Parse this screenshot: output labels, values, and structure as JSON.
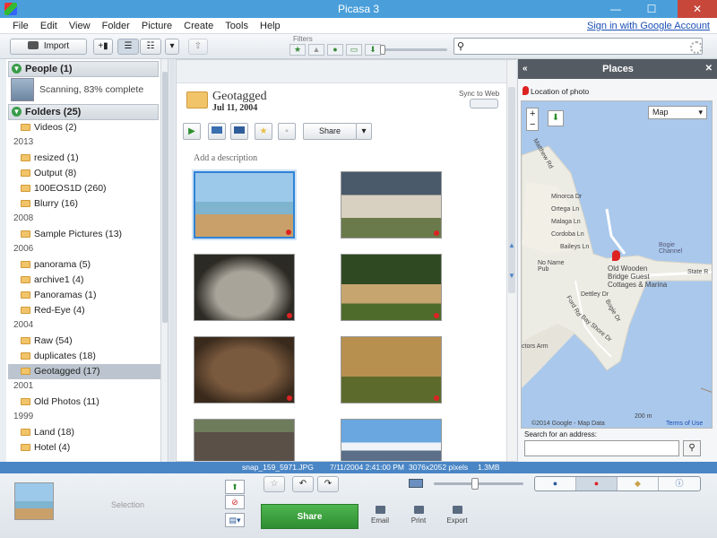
{
  "window": {
    "title": "Picasa 3",
    "minimize": "—",
    "maximize": "☐",
    "close": "✕"
  },
  "menu": {
    "items": [
      "File",
      "Edit",
      "View",
      "Folder",
      "Picture",
      "Create",
      "Tools",
      "Help"
    ],
    "signin": "Sign in with Google Account"
  },
  "toolbar": {
    "import_label": "Import",
    "filters_label": "Filters"
  },
  "people": {
    "header": "People (1)",
    "scanning_text": "Scanning, 83% complete"
  },
  "folders": {
    "header": "Folders (25)",
    "groups": [
      {
        "year": "",
        "items": [
          "Videos (2)"
        ]
      },
      {
        "year": "2013",
        "items": [
          "resized (1)",
          "Output (8)",
          "100EOS1D (260)",
          "Blurry (16)"
        ]
      },
      {
        "year": "2008",
        "items": [
          "Sample Pictures (13)"
        ]
      },
      {
        "year": "2006",
        "items": [
          "panorama (5)",
          "archive1 (4)",
          "Panoramas (1)",
          "Red-Eye (4)"
        ]
      },
      {
        "year": "2004",
        "items": [
          "Raw (54)",
          "duplicates (18)",
          "Geotagged (17)"
        ]
      },
      {
        "year": "2001",
        "items": [
          "Old Photos (11)"
        ]
      },
      {
        "year": "1999",
        "items": [
          "Land (18)",
          "Hotel (4)"
        ]
      }
    ],
    "selected": "Geotagged (17)"
  },
  "album": {
    "title": "Geotagged",
    "date": "Jul 11, 2004",
    "sync_label": "Sync to Web",
    "share_label": "Share",
    "description_placeholder": "Add a description"
  },
  "places": {
    "header": "Places",
    "location_label": "Location of photo",
    "map_type": "Map",
    "zoom_in": "+",
    "zoom_out": "−",
    "labels": {
      "matthew": "Matthew Rd",
      "minorca": "Minorca Dr",
      "ortega": "Ortega Ln",
      "malaga": "Malaga Ln",
      "cordoba": "Cordoba Ln",
      "baileys": "Baileys Ln",
      "noname": "No Name\nPub",
      "oldwooden": "Old Wooden\nBridge Guest\nCottages & Marina",
      "bogie": "Bogie\nChannel",
      "state": "State R",
      "dettley": "Dettley Dr",
      "fordrd": "Ford Rd",
      "bogiedr": "Bogie Dr",
      "bayshore": "Bay Shore Dr",
      "actors": "ctors Arm",
      "copyright": "©2014 Google - Map Data",
      "scale": "200 m",
      "terms": "Terms of Use"
    },
    "address_label": "Search for an address:"
  },
  "status": {
    "filename": "snap_159_5971.JPG",
    "datetime": "7/11/2004 2:41:00 PM",
    "dimensions": "3076x2052 pixels",
    "size": "1.3MB"
  },
  "tray": {
    "selection_label": "Selection",
    "share_label": "Share",
    "actions": [
      "Email",
      "Print",
      "Export"
    ]
  },
  "colors": {
    "accent": "#4a9fdb",
    "share_green": "#3aa23c",
    "pin_red": "#d22222",
    "map_water": "#a9c8ec"
  }
}
